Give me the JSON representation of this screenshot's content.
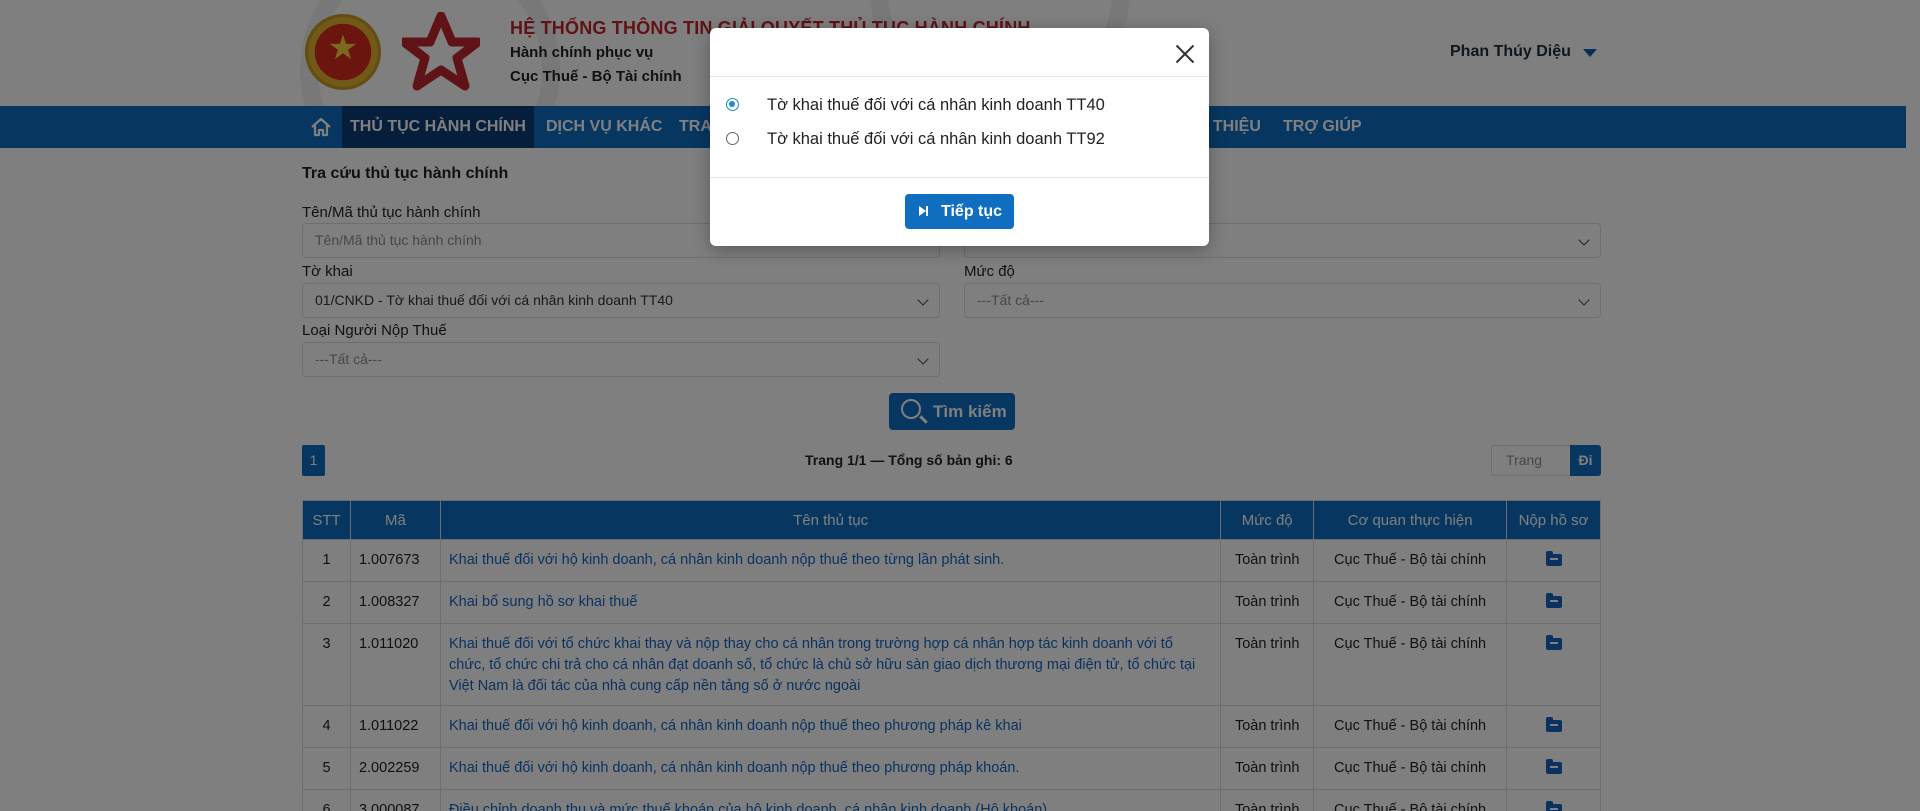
{
  "header": {
    "title": "HỆ THỐNG THÔNG TIN GIẢI QUYẾT THỦ TỤC HÀNH CHÍNH",
    "subtitle1": "Hành chính phục vụ",
    "subtitle2": "Cục Thuế - Bộ Tài chính",
    "user_name": "Phan Thúy Diệu"
  },
  "nav": {
    "items": [
      {
        "label": "THỦ TỤC HÀNH CHÍNH"
      },
      {
        "label": "DỊCH VỤ KHÁC"
      },
      {
        "label": "TRA"
      },
      {
        "label": "I THIỆU"
      },
      {
        "label": "TRỢ GIÚP"
      }
    ]
  },
  "search": {
    "section_title": "Tra cứu thủ tục hành chính",
    "name_label": "Tên/Mã thủ tục hành chính",
    "name_placeholder": "Tên/Mã thủ tục hành chính",
    "form_label": "Tờ khai",
    "form_value": "01/CNKD - Tờ khai thuế đối với cá nhân kinh doanh TT40",
    "level_label": "Mức độ",
    "level_value": "---Tất cả---",
    "taxpayer_label": "Loại Người Nộp Thuế",
    "taxpayer_value": "---Tất cả---",
    "search_button": "Tìm kiếm"
  },
  "pagination": {
    "current_page": "1",
    "info": "Trang 1/1 — Tổng số bản ghi: 6",
    "page_placeholder": "Trang",
    "go_button": "Đi"
  },
  "table": {
    "headers": [
      "STT",
      "Mã",
      "Tên thủ tục",
      "Mức độ",
      "Cơ quan thực hiện",
      "Nộp hồ sơ"
    ],
    "rows": [
      {
        "stt": "1",
        "code": "1.007673",
        "name": "Khai thuế đối với hộ kinh doanh, cá nhân kinh doanh nộp thuế theo từng lần phát sinh.",
        "level": "Toàn trình",
        "agency": "Cục Thuế - Bộ tài chính"
      },
      {
        "stt": "2",
        "code": "1.008327",
        "name": "Khai bổ sung hồ sơ khai thuế",
        "level": "Toàn trình",
        "agency": "Cục Thuế - Bộ tài chính"
      },
      {
        "stt": "3",
        "code": "1.011020",
        "name": "Khai thuế đối với tổ chức khai thay và nộp thay cho cá nhân trong trường hợp cá nhân hợp tác kinh doanh với tổ chức, tổ chức chi trả cho cá nhân đạt doanh số, tổ chức là chủ sở hữu sàn giao dịch thương mại điện tử, tổ chức tại Việt Nam là đối tác của nhà cung cấp nền tảng số ở nước ngoài",
        "level": "Toàn trình",
        "agency": "Cục Thuế - Bộ tài chính"
      },
      {
        "stt": "4",
        "code": "1.011022",
        "name": "Khai thuế đối với hộ kinh doanh, cá nhân kinh doanh nộp thuế theo phương pháp kê khai",
        "level": "Toàn trình",
        "agency": "Cục Thuế - Bộ tài chính"
      },
      {
        "stt": "5",
        "code": "2.002259",
        "name": "Khai thuế đối với hộ kinh doanh, cá nhân kinh doanh nộp thuế theo phương pháp khoán.",
        "level": "Toàn trình",
        "agency": "Cục Thuế - Bộ tài chính"
      },
      {
        "stt": "6",
        "code": "3.000087",
        "name": "Điều chỉnh doanh thu và mức thuế khoán của hộ kinh doanh, cá nhân kinh doanh (Hộ khoán)",
        "level": "Toàn trình",
        "agency": "Cục Thuế - Bộ tài chính"
      }
    ]
  },
  "modal": {
    "options": [
      {
        "label": "Tờ khai thuế đối với cá nhân kinh doanh TT40",
        "selected": true
      },
      {
        "label": "Tờ khai thuế đối với cá nhân kinh doanh TT92",
        "selected": false
      }
    ],
    "continue_button": "Tiếp tục"
  },
  "icons": {
    "home": "home-icon",
    "search": "search-icon",
    "close": "close-icon",
    "continue": "skip-forward-icon",
    "submit": "folder-icon"
  },
  "colors": {
    "primary": "#0f6ec0",
    "nav_active": "#0a3d78",
    "title_red": "#c0262d",
    "link": "#1565c0"
  }
}
